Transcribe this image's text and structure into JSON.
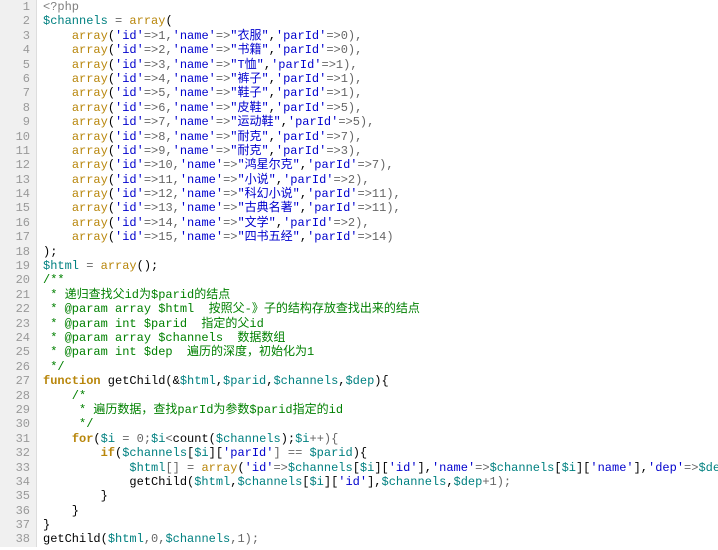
{
  "lineCount": 38,
  "lines": [
    [
      {
        "t": "<?php",
        "c": "c-php"
      }
    ],
    [
      {
        "t": "$channels",
        "c": "c-var"
      },
      {
        "t": " = ",
        "c": "c-op"
      },
      {
        "t": "array",
        "c": "c-arr"
      },
      {
        "t": "(",
        "c": "c-punc"
      }
    ],
    [
      {
        "t": "    ",
        "c": ""
      },
      {
        "t": "array",
        "c": "c-arr"
      },
      {
        "t": "(",
        "c": "c-punc"
      },
      {
        "t": "'id'",
        "c": "c-key"
      },
      {
        "t": "=>1,",
        "c": "c-op"
      },
      {
        "t": "'name'",
        "c": "c-key"
      },
      {
        "t": "=>",
        "c": "c-op"
      },
      {
        "t": "\"衣服\"",
        "c": "c-str"
      },
      {
        "t": ",",
        "c": "c-punc"
      },
      {
        "t": "'parId'",
        "c": "c-key"
      },
      {
        "t": "=>0),",
        "c": "c-op"
      }
    ],
    [
      {
        "t": "    ",
        "c": ""
      },
      {
        "t": "array",
        "c": "c-arr"
      },
      {
        "t": "(",
        "c": "c-punc"
      },
      {
        "t": "'id'",
        "c": "c-key"
      },
      {
        "t": "=>2,",
        "c": "c-op"
      },
      {
        "t": "'name'",
        "c": "c-key"
      },
      {
        "t": "=>",
        "c": "c-op"
      },
      {
        "t": "\"书籍\"",
        "c": "c-str"
      },
      {
        "t": ",",
        "c": "c-punc"
      },
      {
        "t": "'parId'",
        "c": "c-key"
      },
      {
        "t": "=>0),",
        "c": "c-op"
      }
    ],
    [
      {
        "t": "    ",
        "c": ""
      },
      {
        "t": "array",
        "c": "c-arr"
      },
      {
        "t": "(",
        "c": "c-punc"
      },
      {
        "t": "'id'",
        "c": "c-key"
      },
      {
        "t": "=>3,",
        "c": "c-op"
      },
      {
        "t": "'name'",
        "c": "c-key"
      },
      {
        "t": "=>",
        "c": "c-op"
      },
      {
        "t": "\"T恤\"",
        "c": "c-str"
      },
      {
        "t": ",",
        "c": "c-punc"
      },
      {
        "t": "'parId'",
        "c": "c-key"
      },
      {
        "t": "=>1),",
        "c": "c-op"
      }
    ],
    [
      {
        "t": "    ",
        "c": ""
      },
      {
        "t": "array",
        "c": "c-arr"
      },
      {
        "t": "(",
        "c": "c-punc"
      },
      {
        "t": "'id'",
        "c": "c-key"
      },
      {
        "t": "=>4,",
        "c": "c-op"
      },
      {
        "t": "'name'",
        "c": "c-key"
      },
      {
        "t": "=>",
        "c": "c-op"
      },
      {
        "t": "\"裤子\"",
        "c": "c-str"
      },
      {
        "t": ",",
        "c": "c-punc"
      },
      {
        "t": "'parId'",
        "c": "c-key"
      },
      {
        "t": "=>1),",
        "c": "c-op"
      }
    ],
    [
      {
        "t": "    ",
        "c": ""
      },
      {
        "t": "array",
        "c": "c-arr"
      },
      {
        "t": "(",
        "c": "c-punc"
      },
      {
        "t": "'id'",
        "c": "c-key"
      },
      {
        "t": "=>5,",
        "c": "c-op"
      },
      {
        "t": "'name'",
        "c": "c-key"
      },
      {
        "t": "=>",
        "c": "c-op"
      },
      {
        "t": "\"鞋子\"",
        "c": "c-str"
      },
      {
        "t": ",",
        "c": "c-punc"
      },
      {
        "t": "'parId'",
        "c": "c-key"
      },
      {
        "t": "=>1),",
        "c": "c-op"
      }
    ],
    [
      {
        "t": "    ",
        "c": ""
      },
      {
        "t": "array",
        "c": "c-arr"
      },
      {
        "t": "(",
        "c": "c-punc"
      },
      {
        "t": "'id'",
        "c": "c-key"
      },
      {
        "t": "=>6,",
        "c": "c-op"
      },
      {
        "t": "'name'",
        "c": "c-key"
      },
      {
        "t": "=>",
        "c": "c-op"
      },
      {
        "t": "\"皮鞋\"",
        "c": "c-str"
      },
      {
        "t": ",",
        "c": "c-punc"
      },
      {
        "t": "'parId'",
        "c": "c-key"
      },
      {
        "t": "=>5),",
        "c": "c-op"
      }
    ],
    [
      {
        "t": "    ",
        "c": ""
      },
      {
        "t": "array",
        "c": "c-arr"
      },
      {
        "t": "(",
        "c": "c-punc"
      },
      {
        "t": "'id'",
        "c": "c-key"
      },
      {
        "t": "=>7,",
        "c": "c-op"
      },
      {
        "t": "'name'",
        "c": "c-key"
      },
      {
        "t": "=>",
        "c": "c-op"
      },
      {
        "t": "\"运动鞋\"",
        "c": "c-str"
      },
      {
        "t": ",",
        "c": "c-punc"
      },
      {
        "t": "'parId'",
        "c": "c-key"
      },
      {
        "t": "=>5),",
        "c": "c-op"
      }
    ],
    [
      {
        "t": "    ",
        "c": ""
      },
      {
        "t": "array",
        "c": "c-arr"
      },
      {
        "t": "(",
        "c": "c-punc"
      },
      {
        "t": "'id'",
        "c": "c-key"
      },
      {
        "t": "=>8,",
        "c": "c-op"
      },
      {
        "t": "'name'",
        "c": "c-key"
      },
      {
        "t": "=>",
        "c": "c-op"
      },
      {
        "t": "\"耐克\"",
        "c": "c-str"
      },
      {
        "t": ",",
        "c": "c-punc"
      },
      {
        "t": "'parId'",
        "c": "c-key"
      },
      {
        "t": "=>7),",
        "c": "c-op"
      }
    ],
    [
      {
        "t": "    ",
        "c": ""
      },
      {
        "t": "array",
        "c": "c-arr"
      },
      {
        "t": "(",
        "c": "c-punc"
      },
      {
        "t": "'id'",
        "c": "c-key"
      },
      {
        "t": "=>9,",
        "c": "c-op"
      },
      {
        "t": "'name'",
        "c": "c-key"
      },
      {
        "t": "=>",
        "c": "c-op"
      },
      {
        "t": "\"耐克\"",
        "c": "c-str"
      },
      {
        "t": ",",
        "c": "c-punc"
      },
      {
        "t": "'parId'",
        "c": "c-key"
      },
      {
        "t": "=>3),",
        "c": "c-op"
      }
    ],
    [
      {
        "t": "    ",
        "c": ""
      },
      {
        "t": "array",
        "c": "c-arr"
      },
      {
        "t": "(",
        "c": "c-punc"
      },
      {
        "t": "'id'",
        "c": "c-key"
      },
      {
        "t": "=>10,",
        "c": "c-op"
      },
      {
        "t": "'name'",
        "c": "c-key"
      },
      {
        "t": "=>",
        "c": "c-op"
      },
      {
        "t": "\"鸿星尔克\"",
        "c": "c-str"
      },
      {
        "t": ",",
        "c": "c-punc"
      },
      {
        "t": "'parId'",
        "c": "c-key"
      },
      {
        "t": "=>7),",
        "c": "c-op"
      }
    ],
    [
      {
        "t": "    ",
        "c": ""
      },
      {
        "t": "array",
        "c": "c-arr"
      },
      {
        "t": "(",
        "c": "c-punc"
      },
      {
        "t": "'id'",
        "c": "c-key"
      },
      {
        "t": "=>11,",
        "c": "c-op"
      },
      {
        "t": "'name'",
        "c": "c-key"
      },
      {
        "t": "=>",
        "c": "c-op"
      },
      {
        "t": "\"小说\"",
        "c": "c-str"
      },
      {
        "t": ",",
        "c": "c-punc"
      },
      {
        "t": "'parId'",
        "c": "c-key"
      },
      {
        "t": "=>2),",
        "c": "c-op"
      }
    ],
    [
      {
        "t": "    ",
        "c": ""
      },
      {
        "t": "array",
        "c": "c-arr"
      },
      {
        "t": "(",
        "c": "c-punc"
      },
      {
        "t": "'id'",
        "c": "c-key"
      },
      {
        "t": "=>12,",
        "c": "c-op"
      },
      {
        "t": "'name'",
        "c": "c-key"
      },
      {
        "t": "=>",
        "c": "c-op"
      },
      {
        "t": "\"科幻小说\"",
        "c": "c-str"
      },
      {
        "t": ",",
        "c": "c-punc"
      },
      {
        "t": "'parId'",
        "c": "c-key"
      },
      {
        "t": "=>11),",
        "c": "c-op"
      }
    ],
    [
      {
        "t": "    ",
        "c": ""
      },
      {
        "t": "array",
        "c": "c-arr"
      },
      {
        "t": "(",
        "c": "c-punc"
      },
      {
        "t": "'id'",
        "c": "c-key"
      },
      {
        "t": "=>13,",
        "c": "c-op"
      },
      {
        "t": "'name'",
        "c": "c-key"
      },
      {
        "t": "=>",
        "c": "c-op"
      },
      {
        "t": "\"古典名著\"",
        "c": "c-str"
      },
      {
        "t": ",",
        "c": "c-punc"
      },
      {
        "t": "'parId'",
        "c": "c-key"
      },
      {
        "t": "=>11),",
        "c": "c-op"
      }
    ],
    [
      {
        "t": "    ",
        "c": ""
      },
      {
        "t": "array",
        "c": "c-arr"
      },
      {
        "t": "(",
        "c": "c-punc"
      },
      {
        "t": "'id'",
        "c": "c-key"
      },
      {
        "t": "=>14,",
        "c": "c-op"
      },
      {
        "t": "'name'",
        "c": "c-key"
      },
      {
        "t": "=>",
        "c": "c-op"
      },
      {
        "t": "\"文学\"",
        "c": "c-str"
      },
      {
        "t": ",",
        "c": "c-punc"
      },
      {
        "t": "'parId'",
        "c": "c-key"
      },
      {
        "t": "=>2),",
        "c": "c-op"
      }
    ],
    [
      {
        "t": "    ",
        "c": ""
      },
      {
        "t": "array",
        "c": "c-arr"
      },
      {
        "t": "(",
        "c": "c-punc"
      },
      {
        "t": "'id'",
        "c": "c-key"
      },
      {
        "t": "=>15,",
        "c": "c-op"
      },
      {
        "t": "'name'",
        "c": "c-key"
      },
      {
        "t": "=>",
        "c": "c-op"
      },
      {
        "t": "\"四书五经\"",
        "c": "c-str"
      },
      {
        "t": ",",
        "c": "c-punc"
      },
      {
        "t": "'parId'",
        "c": "c-key"
      },
      {
        "t": "=>14)",
        "c": "c-op"
      }
    ],
    [
      {
        "t": ");",
        "c": "c-punc"
      }
    ],
    [
      {
        "t": "$html",
        "c": "c-var"
      },
      {
        "t": " = ",
        "c": "c-op"
      },
      {
        "t": "array",
        "c": "c-arr"
      },
      {
        "t": "();",
        "c": "c-punc"
      }
    ],
    [
      {
        "t": "/**",
        "c": "c-cmt"
      }
    ],
    [
      {
        "t": " * 递归查找父id为$parid的结点",
        "c": "c-cmt"
      }
    ],
    [
      {
        "t": " * @param array $html  按照父-》子的结构存放查找出来的结点",
        "c": "c-cmt"
      }
    ],
    [
      {
        "t": " * @param int $parid  指定的父id",
        "c": "c-cmt"
      }
    ],
    [
      {
        "t": " * @param array $channels  数据数组",
        "c": "c-cmt"
      }
    ],
    [
      {
        "t": " * @param int $dep  遍历的深度，初始化为1",
        "c": "c-cmt"
      }
    ],
    [
      {
        "t": " */",
        "c": "c-cmt"
      }
    ],
    [
      {
        "t": "function",
        "c": "c-fkw"
      },
      {
        "t": " getChild(&",
        "c": "c-punc"
      },
      {
        "t": "$html",
        "c": "c-var"
      },
      {
        "t": ",",
        "c": "c-punc"
      },
      {
        "t": "$parid",
        "c": "c-var"
      },
      {
        "t": ",",
        "c": "c-punc"
      },
      {
        "t": "$channels",
        "c": "c-var"
      },
      {
        "t": ",",
        "c": "c-punc"
      },
      {
        "t": "$dep",
        "c": "c-var"
      },
      {
        "t": "){",
        "c": "c-punc"
      }
    ],
    [
      {
        "t": "    /*",
        "c": "c-cmt"
      }
    ],
    [
      {
        "t": "     * 遍历数据，查找parId为参数$parid指定的id",
        "c": "c-cmt"
      }
    ],
    [
      {
        "t": "     */",
        "c": "c-cmt"
      }
    ],
    [
      {
        "t": "    ",
        "c": ""
      },
      {
        "t": "for",
        "c": "c-for"
      },
      {
        "t": "(",
        "c": "c-punc"
      },
      {
        "t": "$i",
        "c": "c-var"
      },
      {
        "t": " = 0;",
        "c": "c-op"
      },
      {
        "t": "$i",
        "c": "c-var"
      },
      {
        "t": "<",
        "c": "c-op"
      },
      {
        "t": "count",
        "c": "c-call"
      },
      {
        "t": "(",
        "c": "c-punc"
      },
      {
        "t": "$channels",
        "c": "c-var"
      },
      {
        "t": ");",
        "c": "c-punc"
      },
      {
        "t": "$i",
        "c": "c-var"
      },
      {
        "t": "++){",
        "c": "c-op"
      }
    ],
    [
      {
        "t": "        ",
        "c": ""
      },
      {
        "t": "if",
        "c": "c-if"
      },
      {
        "t": "(",
        "c": "c-punc"
      },
      {
        "t": "$channels",
        "c": "c-var"
      },
      {
        "t": "[",
        "c": "c-punc"
      },
      {
        "t": "$i",
        "c": "c-var"
      },
      {
        "t": "][",
        "c": "c-punc"
      },
      {
        "t": "'parId'",
        "c": "c-key"
      },
      {
        "t": "] == ",
        "c": "c-op"
      },
      {
        "t": "$parid",
        "c": "c-var"
      },
      {
        "t": "){",
        "c": "c-punc"
      }
    ],
    [
      {
        "t": "            ",
        "c": ""
      },
      {
        "t": "$html",
        "c": "c-var"
      },
      {
        "t": "[] = ",
        "c": "c-op"
      },
      {
        "t": "array",
        "c": "c-arr"
      },
      {
        "t": "(",
        "c": "c-punc"
      },
      {
        "t": "'id'",
        "c": "c-key"
      },
      {
        "t": "=>",
        "c": "c-op"
      },
      {
        "t": "$channels",
        "c": "c-var"
      },
      {
        "t": "[",
        "c": "c-punc"
      },
      {
        "t": "$i",
        "c": "c-var"
      },
      {
        "t": "][",
        "c": "c-punc"
      },
      {
        "t": "'id'",
        "c": "c-key"
      },
      {
        "t": "],",
        "c": "c-punc"
      },
      {
        "t": "'name'",
        "c": "c-key"
      },
      {
        "t": "=>",
        "c": "c-op"
      },
      {
        "t": "$channels",
        "c": "c-var"
      },
      {
        "t": "[",
        "c": "c-punc"
      },
      {
        "t": "$i",
        "c": "c-var"
      },
      {
        "t": "][",
        "c": "c-punc"
      },
      {
        "t": "'name'",
        "c": "c-key"
      },
      {
        "t": "],",
        "c": "c-punc"
      },
      {
        "t": "'dep'",
        "c": "c-key"
      },
      {
        "t": "=>",
        "c": "c-op"
      },
      {
        "t": "$dep",
        "c": "c-var"
      },
      {
        "t": ");",
        "c": "c-punc"
      }
    ],
    [
      {
        "t": "            getChild(",
        "c": "c-punc"
      },
      {
        "t": "$html",
        "c": "c-var"
      },
      {
        "t": ",",
        "c": "c-punc"
      },
      {
        "t": "$channels",
        "c": "c-var"
      },
      {
        "t": "[",
        "c": "c-punc"
      },
      {
        "t": "$i",
        "c": "c-var"
      },
      {
        "t": "][",
        "c": "c-punc"
      },
      {
        "t": "'id'",
        "c": "c-key"
      },
      {
        "t": "],",
        "c": "c-punc"
      },
      {
        "t": "$channels",
        "c": "c-var"
      },
      {
        "t": ",",
        "c": "c-punc"
      },
      {
        "t": "$dep",
        "c": "c-var"
      },
      {
        "t": "+1);",
        "c": "c-op"
      }
    ],
    [
      {
        "t": "        }",
        "c": "c-punc"
      }
    ],
    [
      {
        "t": "    }",
        "c": "c-punc"
      }
    ],
    [
      {
        "t": "}",
        "c": "c-punc"
      }
    ],
    [
      {
        "t": "getChild(",
        "c": "c-punc"
      },
      {
        "t": "$html",
        "c": "c-var"
      },
      {
        "t": ",0,",
        "c": "c-op"
      },
      {
        "t": "$channels",
        "c": "c-var"
      },
      {
        "t": ",1);",
        "c": "c-op"
      }
    ]
  ]
}
